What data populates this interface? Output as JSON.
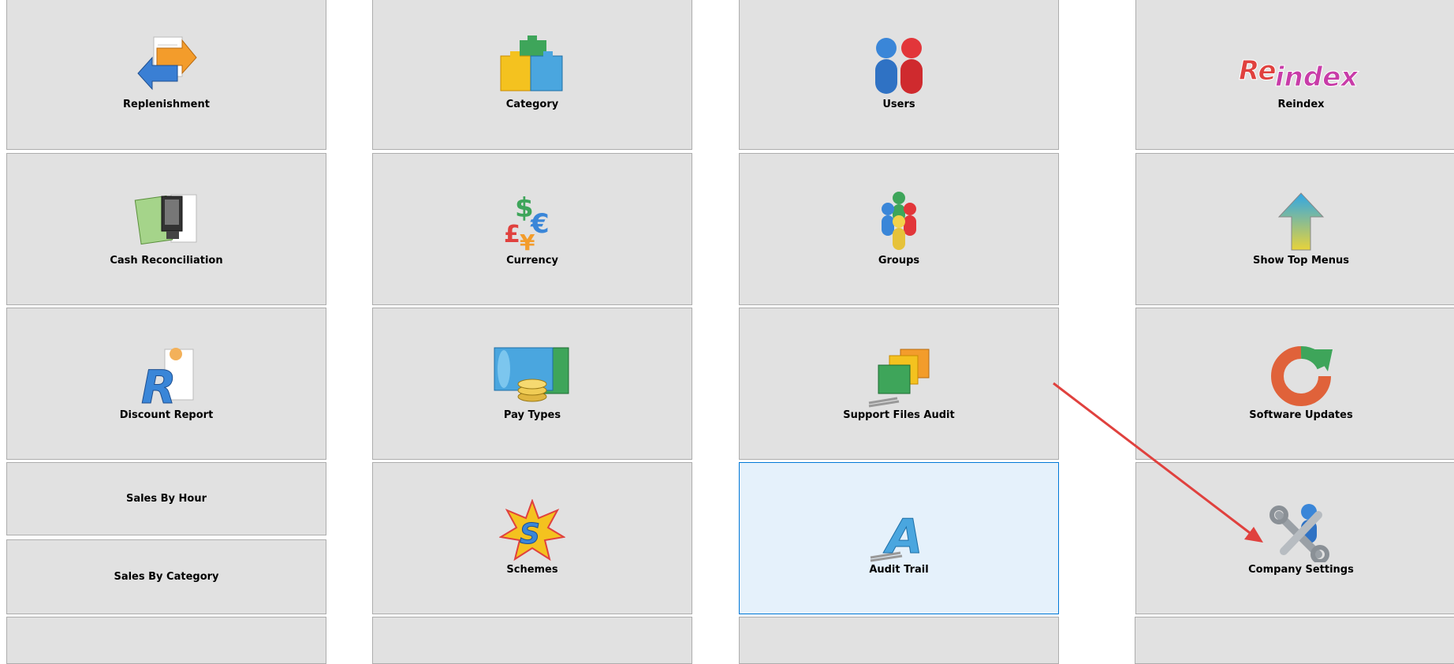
{
  "tiles": {
    "replenishment": "Replenishment",
    "category": "Category",
    "users": "Users",
    "reindex": "Reindex",
    "reindex_logo_re": "Re",
    "reindex_logo_index": "index",
    "cash_reconciliation": "Cash Reconciliation",
    "currency": "Currency",
    "groups": "Groups",
    "show_top_menus": "Show Top Menus",
    "discount_report": "Discount Report",
    "pay_types": "Pay Types",
    "support_files_audit": "Support Files Audit",
    "software_updates": "Software Updates",
    "sales_by_hour": "Sales By Hour",
    "sales_by_category": "Sales By Category",
    "schemes": "Schemes",
    "audit_trail": "Audit Trail",
    "company_settings": "Company Settings"
  },
  "colors": {
    "tile_bg": "#e1e1e1",
    "tile_border": "#adadad",
    "selected_bg": "#e5f1fb",
    "selected_border": "#0078d7",
    "annotation_arrow": "#e0413e"
  },
  "selected_tile": "audit_trail"
}
